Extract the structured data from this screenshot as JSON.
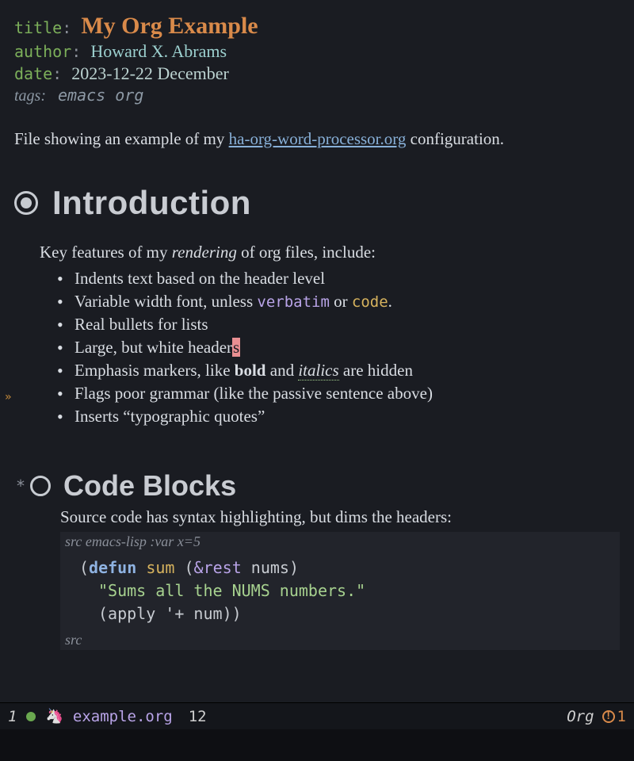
{
  "meta": {
    "title_key": "title",
    "title_val": "My Org Example",
    "author_key": "author",
    "author_val": "Howard X. Abrams",
    "date_key": "date",
    "date_val": "2023-12-22 December",
    "tags_key": "tags:",
    "tags_val": "emacs org"
  },
  "intro_para_pre": "File showing an example of my ",
  "intro_link": "ha-org-word-processor.org",
  "intro_para_post": " configuration.",
  "h1": "Introduction",
  "features_lead_pre": "Key features of my ",
  "features_lead_em": "rendering",
  "features_lead_post": " of org files, include:",
  "features": [
    {
      "text": "Indents text based on the header level"
    },
    {
      "pre": "Variable width font, unless ",
      "verbatim": "verbatim",
      "mid": " or ",
      "code": "code",
      "post": "."
    },
    {
      "text": "Real bullets for lists"
    },
    {
      "pre": "Large, but white header",
      "cursor": "s"
    },
    {
      "pre": "Emphasis markers, like ",
      "bold": "bold",
      "mid": " and ",
      "italic": "italics",
      "post": " are hidden"
    },
    {
      "text": "Flags poor grammar (like the passive sentence above)"
    },
    {
      "text": "Inserts “typographic quotes”"
    }
  ],
  "h2": "Code Blocks",
  "h2_desc": "Source code has syntax highlighting, but dims the headers:",
  "src_header_kw": "src",
  "src_header_rest": " emacs-lisp :var x=5",
  "code_lines": {
    "l1_open": "(",
    "l1_defun": "defun",
    "l1_sp": " ",
    "l1_name": "sum",
    "l1_sp2": " (",
    "l1_amp": "&rest",
    "l1_args": " nums",
    "l1_close": ")",
    "l2_doc": "\"Sums all the NUMS numbers.\"",
    "l3_open": "(",
    "l3_apply": "apply",
    "l3_rest": " '+ num",
    "l3_close": "))"
  },
  "src_end_kw": "src",
  "modeline": {
    "win_num": "1",
    "file": "example.org",
    "line": "12",
    "mode": "Org",
    "warn_count": "1"
  }
}
